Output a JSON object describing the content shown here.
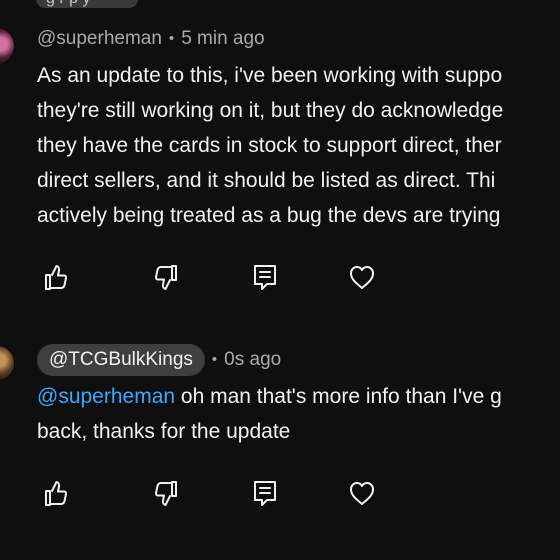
{
  "top_fragment": "g   r  p  y",
  "comments": [
    {
      "handle": "@superheman",
      "time": "5 min ago",
      "lines": [
        "As an update to this, i've been working with suppo",
        "they're still working on it, but they do acknowledge",
        "they have the cards in stock to support direct, ther",
        "direct sellers, and it should be listed as direct.  Thi",
        "actively being treated as a bug the devs are trying"
      ]
    },
    {
      "handle": "@TCGBulkKings",
      "time": "0s ago",
      "mention": "@superheman",
      "line1_text": " oh man that's more info than I've g",
      "line2": "back, thanks for the update"
    }
  ],
  "icons": {
    "like": "thumbs-up-icon",
    "dislike": "thumbs-down-icon",
    "reply": "reply-icon",
    "heart": "heart-icon"
  }
}
